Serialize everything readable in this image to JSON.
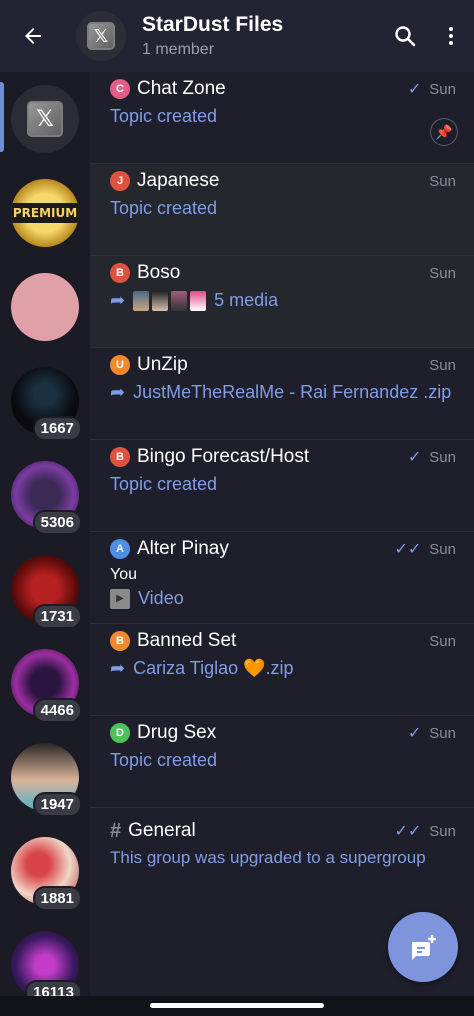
{
  "header": {
    "back_icon": "arrow-left-icon",
    "title": "StarDust Files",
    "subtitle": "1 member",
    "search_icon": "search-icon",
    "menu_icon": "more-vertical-icon"
  },
  "sidebar": {
    "items": [
      {
        "name": "x",
        "badge": null
      },
      {
        "name": "premium",
        "badge": null
      },
      {
        "name": "pink",
        "badge": null
      },
      {
        "name": "candy",
        "badge": "1667"
      },
      {
        "name": "purple",
        "badge": "5306"
      },
      {
        "name": "red",
        "badge": "1731"
      },
      {
        "name": "purple2",
        "badge": "4466"
      },
      {
        "name": "girl",
        "badge": "1947"
      },
      {
        "name": "flowers",
        "badge": "1881"
      },
      {
        "name": "neon",
        "badge": "16113"
      }
    ]
  },
  "topics": [
    {
      "letter": "C",
      "color": "#e35d8a",
      "title": "Chat Zone",
      "time": "Sun",
      "check": "✓",
      "preview": "Topic created",
      "pinned": true
    },
    {
      "letter": "J",
      "color": "#e0523f",
      "title": "Japanese",
      "time": "Sun",
      "check": "",
      "preview": "Topic created"
    },
    {
      "letter": "B",
      "color": "#e0523f",
      "title": "Boso",
      "time": "Sun",
      "check": "",
      "preview": "5 media",
      "forwarded": true,
      "media": true
    },
    {
      "letter": "U",
      "color": "#f08a2c",
      "title": "UnZip",
      "time": "Sun",
      "check": "",
      "preview": "JustMeTheRealMe - Rai Fernandez .zip",
      "forwarded": true
    },
    {
      "letter": "B",
      "color": "#e0523f",
      "title": "Bingo Forecast/Host",
      "time": "Sun",
      "check": "✓",
      "preview": "Topic created"
    },
    {
      "letter": "A",
      "color": "#4e8fe6",
      "title": "Alter Pinay",
      "time": "Sun",
      "check": "✓✓",
      "sender": "You",
      "preview": "Video",
      "video": true
    },
    {
      "letter": "B",
      "color": "#f08a2c",
      "title": "Banned Set",
      "time": "Sun",
      "check": "",
      "preview": "Cariza Tiglao 🧡.zip",
      "forwarded": true
    },
    {
      "letter": "D",
      "color": "#4ec25a",
      "title": "Drug Sex",
      "time": "Sun",
      "check": "✓",
      "preview": "Topic created"
    },
    {
      "letter": "#",
      "color": "",
      "title": "General",
      "time": "Sun",
      "check": "✓✓",
      "preview": "This group was upgraded to a supergroup",
      "hash": true
    }
  ],
  "fab_icon": "new-topic-icon",
  "colors": {
    "accent": "#7f9de6",
    "fab": "#7e95de"
  }
}
